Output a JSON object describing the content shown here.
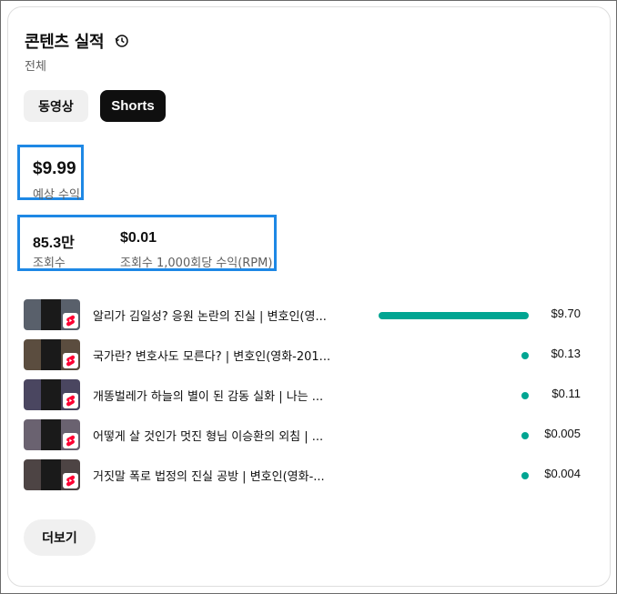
{
  "card": {
    "title": "콘텐츠 실적",
    "subtitle": "전체"
  },
  "tabs": [
    {
      "label": "동영상",
      "selected": false
    },
    {
      "label": "Shorts",
      "selected": true
    }
  ],
  "revenue": {
    "value": "$9.99",
    "label": "예상 수익"
  },
  "views": {
    "value": "85.3만",
    "label": "조회수"
  },
  "rpm": {
    "value": "$0.01",
    "label": "조회수 1,000회당 수익(RPM)"
  },
  "colors": {
    "accent_bar": "#00a592",
    "highlight_box": "#1e88e5",
    "shorts_badge": "#ff0033"
  },
  "content_rows": [
    {
      "title": "알리가 김일성? 응원 논란의 진실 | 변호인(영...",
      "amount": "$9.70",
      "share": 0.971,
      "thumb_color": "#59606b"
    },
    {
      "title": "국가란? 변호사도 모른다? | 변호인(영화-201...",
      "amount": "$0.13",
      "share": 0.013,
      "thumb_color": "#5b4d3f"
    },
    {
      "title": "개똥벌레가 하늘의 별이 된 감동 실화 | 나는 ...",
      "amount": "$0.11",
      "share": 0.011,
      "thumb_color": "#4a4660"
    },
    {
      "title": "어떻게 살 것인가 멋진 형님 이승환의 외침 | ...",
      "amount": "$0.005",
      "share": 0.0005,
      "thumb_color": "#6a6270"
    },
    {
      "title": "거짓말 폭로 법정의 진실 공방 | 변호인(영화-...",
      "amount": "$0.004",
      "share": 0.0004,
      "thumb_color": "#4d4444"
    }
  ],
  "more_button": "더보기"
}
